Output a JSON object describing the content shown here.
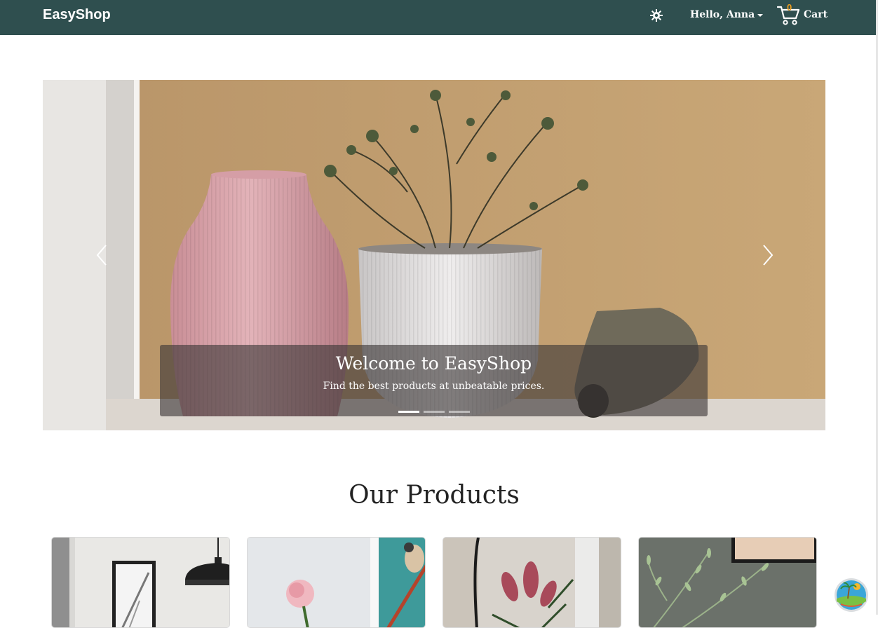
{
  "navbar": {
    "brand": "EasyShop",
    "theme_icon": "sun-gear-icon",
    "user_greeting": "Hello, Anna",
    "cart_count": "0",
    "cart_label": "Cart",
    "background": "#2f4f4f",
    "cart_count_color": "#f0a020"
  },
  "carousel": {
    "slide_caption_title": "Welcome to EasyShop",
    "slide_caption_text": "Find the best products at unbeatable prices.",
    "slide_count": 3,
    "active_slide": 1,
    "prev_icon": "chevron-left-icon",
    "next_icon": "chevron-right-icon"
  },
  "products": {
    "section_title": "Our Products",
    "cards": [
      {
        "image": "pendant-lamp-and-map-print-photo"
      },
      {
        "image": "pink-rose-and-bird-print-photo"
      },
      {
        "image": "pink-flowers-vase-photo"
      },
      {
        "image": "olive-branch-plant-photo"
      }
    ]
  },
  "widget": {
    "icon": "beach-island-icon"
  }
}
